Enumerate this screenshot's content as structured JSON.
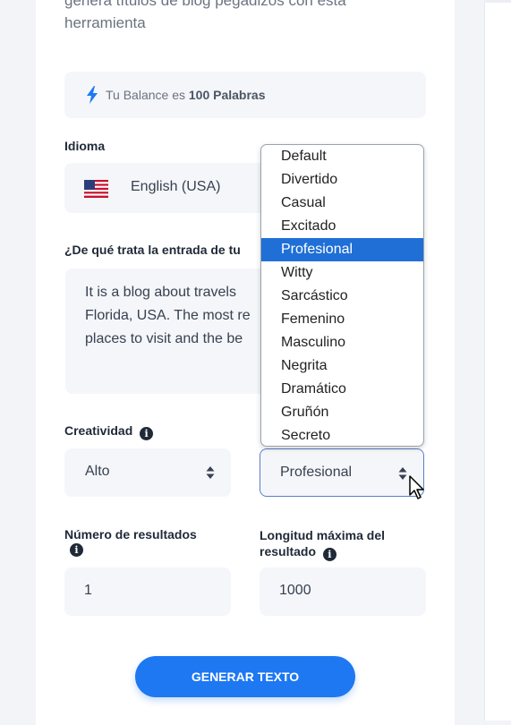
{
  "intro": {
    "line1": "genera títulos de blog pegadizos con esta",
    "line2": "herramienta"
  },
  "balance": {
    "prefix": "Tu Balance es",
    "amount": "100 Palabras",
    "icon": "bolt-icon",
    "accent": "#1d78f2"
  },
  "language": {
    "label": "Idioma",
    "value": "English (USA)",
    "flag_icon": "us-flag-icon"
  },
  "topic": {
    "label": "¿De qué trata la entrada de tu",
    "line1": "It is a blog about travels",
    "line2": "Florida, USA. The most re",
    "line3": "places to visit and the be"
  },
  "creativity": {
    "label": "Creatividad",
    "value": "Alto"
  },
  "tone": {
    "value": "Profesional",
    "options": [
      "Default",
      "Divertido",
      "Casual",
      "Excitado",
      "Profesional",
      "Witty",
      "Sarcástico",
      "Femenino",
      "Masculino",
      "Negrita",
      "Dramático",
      "Gruñón",
      "Secreto"
    ],
    "selected_index": 4,
    "highlight_color": "#1f6fd6"
  },
  "results_count": {
    "label": "Número de resultados",
    "value": "1"
  },
  "max_length": {
    "label_line1": "Longitud máxima del",
    "label_line2": "resultado",
    "value": "1000"
  },
  "info_glyph": "i",
  "generate_button": {
    "label": "GENERAR TEXTO"
  }
}
